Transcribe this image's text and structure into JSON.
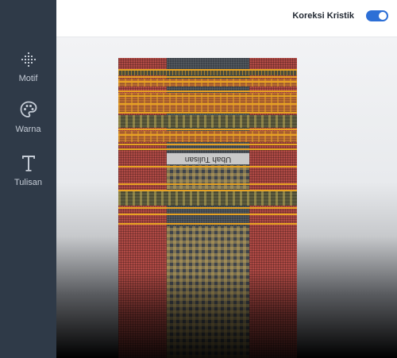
{
  "sidebar": {
    "items": [
      {
        "label": "Motif",
        "icon": "dot-grid-icon"
      },
      {
        "label": "Warna",
        "icon": "palette-icon"
      },
      {
        "label": "Tulisan",
        "icon": "text-t-icon"
      }
    ]
  },
  "header": {
    "koreksi_label": "Koreksi Kristik",
    "koreksi_enabled": true
  },
  "canvas": {
    "text_label": "Ubah Tulisan"
  },
  "colors": {
    "sidebar_bg": "#2f3a48",
    "toggle_accent": "#2d6fd6",
    "fabric_red": "#b04a45",
    "fabric_dark": "#3d434a",
    "stripe_gold": "#e7a323"
  }
}
